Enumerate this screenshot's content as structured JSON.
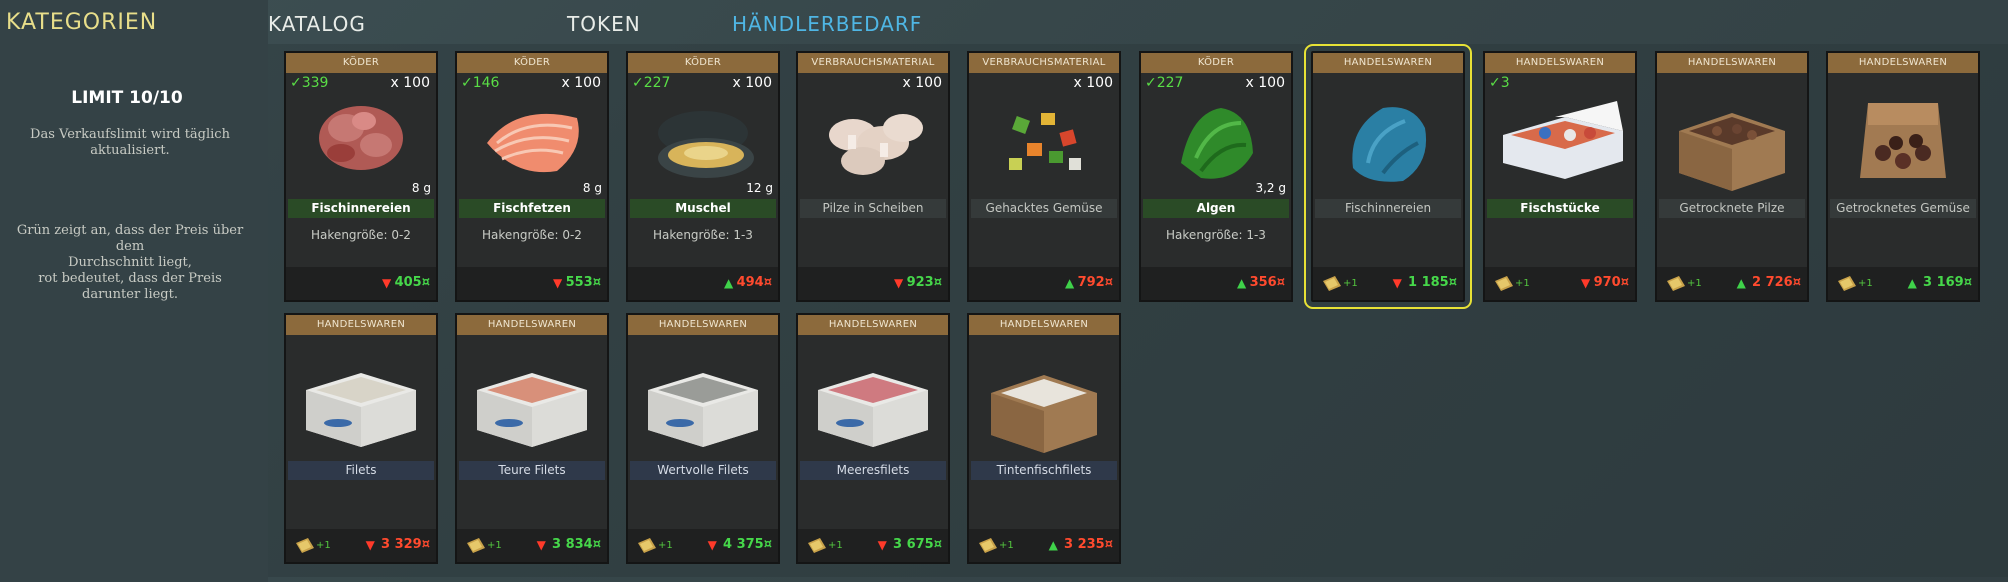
{
  "sidebar": {
    "title": "KATEGORIEN",
    "limit": "LIMIT 10/10",
    "info1": [
      "Das Verkaufslimit wird täglich",
      "aktualisiert."
    ],
    "info2": [
      "Grün zeigt an, dass der Preis über dem",
      "Durchschnitt liegt,",
      "rot bedeutet, dass der Preis darunter liegt."
    ]
  },
  "tabs": [
    {
      "label": "KATALOG",
      "active": false
    },
    {
      "label": "TOKEN",
      "active": false
    },
    {
      "label": "HÄNDLERBEDARF",
      "active": true
    }
  ],
  "colors": {
    "accent": "#4fb6e4",
    "selected": "#e7e236",
    "up": "#46d74a",
    "down": "#ff4a2e",
    "owned": "#5ade46",
    "category_bg": "#8c6a3c"
  },
  "items": [
    {
      "category": "KÖDER",
      "owned": "✓339",
      "qty": "x 100",
      "weight": "8 g",
      "name": "Fischinnereien",
      "name_style": "green",
      "hook": "Hakengröße: 0-2",
      "token": "",
      "trend": "down",
      "price": "405¤",
      "price_color": "green",
      "icon": "fish-guts-icon"
    },
    {
      "category": "KÖDER",
      "owned": "✓146",
      "qty": "x 100",
      "weight": "8 g",
      "name": "Fischfetzen",
      "name_style": "green",
      "hook": "Hakengröße: 0-2",
      "token": "",
      "trend": "down",
      "price": "553¤",
      "price_color": "green",
      "icon": "salmon-fillet-icon"
    },
    {
      "category": "KÖDER",
      "owned": "✓227",
      "qty": "x 100",
      "weight": "12 g",
      "name": "Muschel",
      "name_style": "green",
      "hook": "Hakengröße: 1-3",
      "token": "",
      "trend": "up",
      "price": "494¤",
      "price_color": "red",
      "icon": "mussel-icon"
    },
    {
      "category": "VERBRAUCHSMATERIAL",
      "owned": "",
      "qty": "x 100",
      "weight": "",
      "name": "Pilze in Scheiben",
      "name_style": "grey",
      "hook": "",
      "token": "",
      "trend": "down",
      "price": "923¤",
      "price_color": "green",
      "icon": "sliced-mushroom-icon"
    },
    {
      "category": "VERBRAUCHSMATERIAL",
      "owned": "",
      "qty": "x 100",
      "weight": "",
      "name": "Gehacktes Gemüse",
      "name_style": "grey",
      "hook": "",
      "token": "",
      "trend": "up",
      "price": "792¤",
      "price_color": "red",
      "icon": "chopped-vegetables-icon"
    },
    {
      "category": "KÖDER",
      "owned": "✓227",
      "qty": "x 100",
      "weight": "3,2 g",
      "name": "Algen",
      "name_style": "green",
      "hook": "Hakengröße: 1-3",
      "token": "",
      "trend": "up",
      "price": "356¤",
      "price_color": "red",
      "icon": "seaweed-icon"
    },
    {
      "category": "HANDELSWAREN",
      "owned": "",
      "qty": "",
      "weight": "",
      "name": "Fischinnereien",
      "name_style": "grey",
      "hook": "",
      "token": "+1",
      "trend": "down",
      "price": "1 185¤",
      "price_color": "green",
      "selected": true,
      "icon": "blue-bag-icon"
    },
    {
      "category": "HANDELSWAREN",
      "owned": "✓3",
      "qty": "",
      "weight": "",
      "name": "Fischstücke",
      "name_style": "green",
      "hook": "",
      "token": "+1",
      "trend": "down",
      "price": "970¤",
      "price_color": "red",
      "icon": "fish-box-icon"
    },
    {
      "category": "HANDELSWAREN",
      "owned": "",
      "qty": "",
      "weight": "",
      "name": "Getrocknete Pilze",
      "name_style": "grey",
      "hook": "",
      "token": "+1",
      "trend": "up",
      "price": "2 726¤",
      "price_color": "red",
      "icon": "dried-mushroom-box-icon"
    },
    {
      "category": "HANDELSWAREN",
      "owned": "",
      "qty": "",
      "weight": "",
      "name": "Getrocknetes Gemüse",
      "name_style": "grey",
      "hook": "",
      "token": "+1",
      "trend": "up",
      "price": "3 169¤",
      "price_color": "green",
      "icon": "dried-vegetable-bag-icon"
    },
    {
      "category": "HANDELSWAREN",
      "owned": "",
      "qty": "",
      "weight": "",
      "name": "Filets",
      "name_style": "blue",
      "hook": "",
      "token": "+1",
      "trend": "down",
      "price": "3 329¤",
      "price_color": "red",
      "icon": "fillet-box-white-icon"
    },
    {
      "category": "HANDELSWAREN",
      "owned": "",
      "qty": "",
      "weight": "",
      "name": "Teure Filets",
      "name_style": "blue",
      "hook": "",
      "token": "+1",
      "trend": "down",
      "price": "3 834¤",
      "price_color": "green",
      "icon": "fillet-box-salmon-icon"
    },
    {
      "category": "HANDELSWAREN",
      "owned": "",
      "qty": "",
      "weight": "",
      "name": "Wertvolle Filets",
      "name_style": "blue",
      "hook": "",
      "token": "+1",
      "trend": "down",
      "price": "4 375¤",
      "price_color": "green",
      "icon": "fillet-box-grey-icon"
    },
    {
      "category": "HANDELSWAREN",
      "owned": "",
      "qty": "",
      "weight": "",
      "name": "Meeresfilets",
      "name_style": "blue",
      "hook": "",
      "token": "+1",
      "trend": "down",
      "price": "3 675¤",
      "price_color": "green",
      "icon": "fillet-box-red-icon"
    },
    {
      "category": "HANDELSWAREN",
      "owned": "",
      "qty": "",
      "weight": "",
      "name": "Tintenfischfilets",
      "name_style": "blue",
      "hook": "",
      "token": "+1",
      "trend": "up",
      "price": "3 235¤",
      "price_color": "red",
      "icon": "squid-box-icon"
    }
  ]
}
